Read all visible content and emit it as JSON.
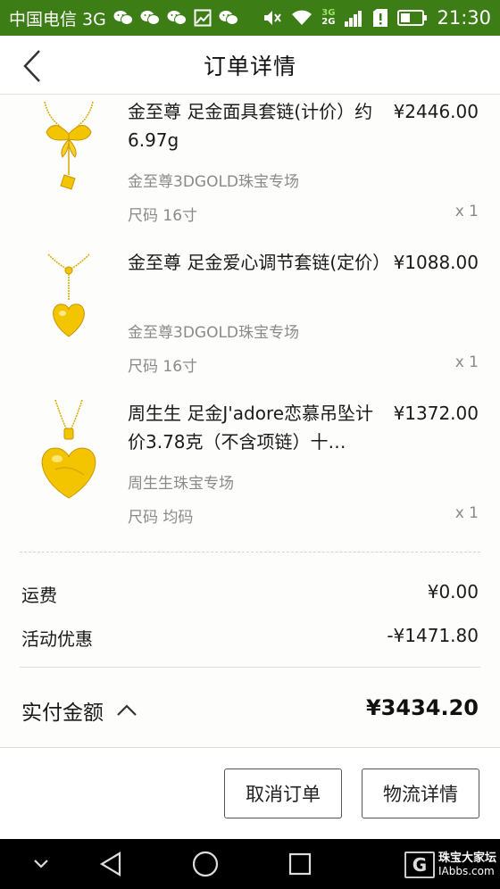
{
  "status_bar": {
    "carrier": "中国电信 3G",
    "network_top": "3G",
    "network_bottom": "2G",
    "time": "21:30"
  },
  "header": {
    "title": "订单详情",
    "back_icon": "chevron-left-icon"
  },
  "order_items": [
    {
      "name": "金至尊 足金面具套链(计价）约6.97g",
      "price": "¥2446.00",
      "store": "金至尊3DGOLD珠宝专场",
      "size": "尺码 16寸",
      "qty": "x 1",
      "image": "butterfly-necklace"
    },
    {
      "name": "金至尊 足金爱心调节套链(定价）",
      "price": "¥1088.00",
      "store": "金至尊3DGOLD珠宝专场",
      "size": "尺码 16寸",
      "qty": "x 1",
      "image": "heart-pendant-necklace"
    },
    {
      "name": "周生生 足金J'adore恋慕吊坠计价3.78克（不含项链）十…",
      "price": "¥1372.00",
      "store": "周生生珠宝专场",
      "size": "尺码 均码",
      "qty": "x 1",
      "image": "jadore-heart-pendant"
    }
  ],
  "summary": {
    "shipping_label": "运费",
    "shipping_value": "¥0.00",
    "discount_label": "活动优惠",
    "discount_value": "-¥1471.80",
    "total_label": "实付金额",
    "total_value": "¥3434.20"
  },
  "actions": {
    "cancel_label": "取消订单",
    "logistics_label": "物流详情"
  },
  "watermark": {
    "logo": "G",
    "line1": "珠宝大家坛",
    "line2": "IAbbs.com"
  },
  "colors": {
    "status_bar": "#3c7d16",
    "gold": "#f2c200"
  }
}
